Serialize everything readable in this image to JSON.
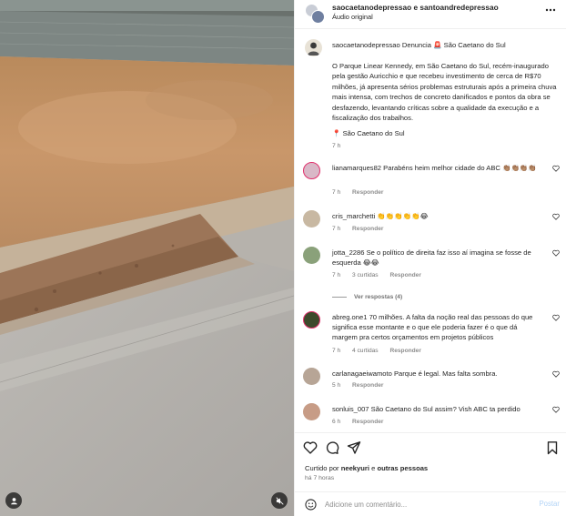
{
  "header": {
    "user_one": "saocaetanodepressao",
    "joiner": "e",
    "user_two": "santoandredepressao",
    "audio": "Áudio original"
  },
  "caption": {
    "user": "saocaetanodepressao",
    "tag": "Denuncia",
    "tag_emoji": "🚨",
    "location_head": "São Caetano do Sul",
    "text": "O Parque Linear Kennedy, em São Caetano do Sul, recém-inaugurado pela gestão Auricchio e que recebeu investimento de cerca de R$70 milhões, já apresenta sérios problemas estruturais após a primeira chuva mais intensa, com trechos de concreto danificados e pontos da obra se desfazendo, levantando críticas sobre a qualidade da execução e a fiscalização dos trabalhos.",
    "location_pin": "📍",
    "location": "São Caetano do Sul",
    "time": "7 h"
  },
  "comments": [
    {
      "user": "lianamarques82",
      "text": "Parabéns heim melhor cidade do ABC 👏🏽👏🏽👏🏽👏🏽",
      "time": "7 h",
      "likes": "",
      "reply": "Responder",
      "avatar_color": "#d9b8c7"
    },
    {
      "user": "cris_marchetti",
      "text": "👏👏👏👏👏😂",
      "time": "7 h",
      "likes": "",
      "reply": "Responder",
      "avatar_color": "#c8b8a2"
    },
    {
      "user": "jotta_2286",
      "text": "Se o político de direita faz isso aí imagina se fosse de esquerda 😂😂",
      "time": "7 h",
      "likes": "3 curtidas",
      "reply": "Responder",
      "avatar_color": "#8aa17a"
    },
    {
      "user": "abreg.one1",
      "text": "70 milhões. A falta da noção real das pessoas do que significa esse montante e o que ele poderia fazer é o que dá margem pra certos orçamentos em projetos públicos",
      "time": "7 h",
      "likes": "4 curtidas",
      "reply": "Responder",
      "avatar_color": "#3d4a2c"
    },
    {
      "user": "carlanagaeiwamoto",
      "text": "Parque é legal. Mas falta sombra.",
      "time": "5 h",
      "likes": "",
      "reply": "Responder",
      "avatar_color": "#b7a596"
    },
    {
      "user": "sonluis_007",
      "text": "São Caetano do Sul assim? Vish ABC ta perdido",
      "time": "6 h",
      "likes": "",
      "reply": "Responder",
      "avatar_color": "#c79c86"
    }
  ],
  "replies_toggle": "Ver respostas (4)",
  "actions": {
    "liked_prefix": "Curtido por",
    "liked_user": "neekyuri",
    "liked_and": "e",
    "liked_others": "outras pessoas",
    "posted_time": "há 7 horas"
  },
  "add_comment": {
    "placeholder": "Adicione um comentário...",
    "post_label": "Postar"
  },
  "colors": {
    "text": "#262626",
    "muted": "#737373",
    "post_disabled": "#b3d4f7",
    "divider": "#efefef"
  },
  "icons": [
    "more-icon",
    "heart-icon",
    "comment-icon",
    "share-icon",
    "bookmark-icon",
    "emoji-icon",
    "user-icon",
    "mute-icon",
    "pin-icon"
  ]
}
